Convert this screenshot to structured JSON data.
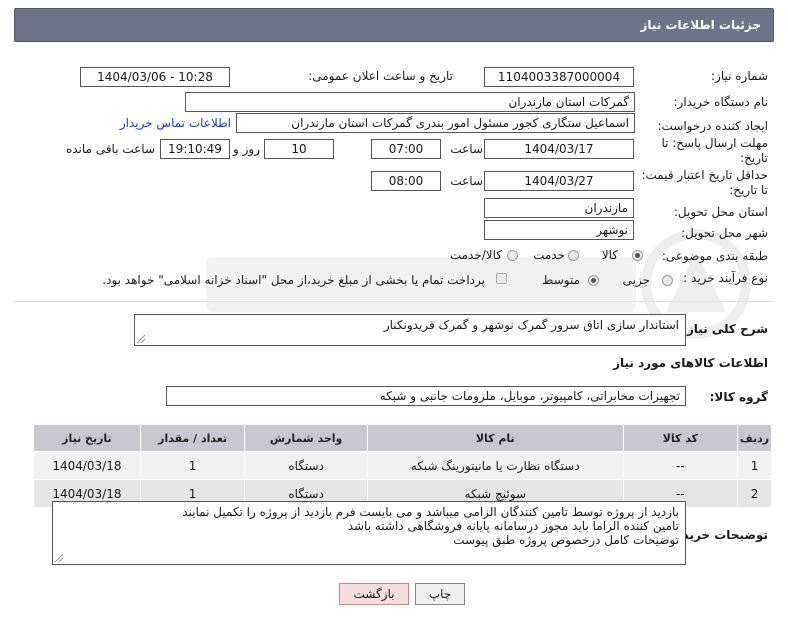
{
  "header": {
    "title": "جزئیات اطلاعات نیاز"
  },
  "fields": {
    "need_number_label": "شماره نیاز:",
    "need_number": "1104003387000004",
    "announce_label": "تاریخ و ساعت اعلان عمومی:",
    "announce_value": "1404/03/06 - 10:28",
    "buyer_org_label": "نام دستگاه خریدار:",
    "buyer_org": "گمرکات استان مازندران",
    "requester_label": "ایجاد کننده درخواست:",
    "requester": "اسماعیل ستگاری کجور مسئول امور بندری گمرکات استان مازندران",
    "contact_link": "اطلاعات تماس خریدار",
    "deadline_label_1": "مهلت ارسال پاسخ: تا",
    "deadline_label_2": "تاریخ:",
    "deadline_date": "1404/03/17",
    "time_label": "ساعت",
    "deadline_time": "07:00",
    "days_count": "10",
    "days_label": "روز و",
    "remaining_time": "19:10:49",
    "remaining_label": "ساعت باقی مانده",
    "validity_label_1": "حداقل تاریخ اعتبار قیمت:",
    "validity_label_2": "تا تاریخ:",
    "validity_date": "1404/03/27",
    "validity_time": "08:00",
    "province_label": "استان محل تحویل:",
    "province": "مازندران",
    "city_label": "شهر محل تحویل:",
    "city": "نوشهر",
    "category_label": "طبقه بندی موضوعی:",
    "category_options": [
      "کالا",
      "خدمت",
      "کالا/خدمت"
    ],
    "category_selected": "کالا",
    "process_label": "نوع فرآیند خرید :",
    "process_options": [
      "جزیی",
      "متوسط"
    ],
    "process_selected": "متوسط",
    "payment_note": "پرداخت تمام یا بخشی از مبلغ خرید،از محل \"اسناد خزانه اسلامی\" خواهد بود."
  },
  "description": {
    "label": "شرح کلی نیاز:",
    "text": "استاندار سازی اتاق سرور گمرک نوشهر و گمرک فریدونکنار"
  },
  "goods": {
    "section_title": "اطلاعات کالاهای مورد نیاز",
    "group_label": "گروه کالا:",
    "group_value": "تجهیزات مخابراتی، کامپیوتر، موبایل، ملزومات جانبی و شبکه",
    "columns": [
      "ردیف",
      "کد کالا",
      "نام کالا",
      "واحد شمارش",
      "تعداد / مقدار",
      "تاریخ نیاز"
    ],
    "rows": [
      [
        "1",
        "--",
        "دستگاه نظارت یا مانیتورینگ شبکه",
        "دستگاه",
        "1",
        "1404/03/18"
      ],
      [
        "2",
        "--",
        "سوئیچ شبکه",
        "دستگاه",
        "1",
        "1404/03/18"
      ]
    ]
  },
  "buyer_notes": {
    "label": "توضیحات خریدار:",
    "lines": [
      "بازدید از پروژه توسط تامین کنندگان الزامی میباشد و می بایست فرم بازدید از پروژه را تکمیل نمایند",
      "تامین کننده الزاما باید مجوز درسامانه پایانه فروشگاهی داشته باشد",
      "توضیحات کامل درخصوص پروژه طبق پیوست"
    ]
  },
  "buttons": {
    "print": "چاپ",
    "back": "بازگشت"
  },
  "colors": {
    "header_bg": "#6b7488",
    "table_header_bg": "#c6c9cf",
    "link": "#1a3fb8",
    "back_btn_bg": "#f7dede"
  }
}
